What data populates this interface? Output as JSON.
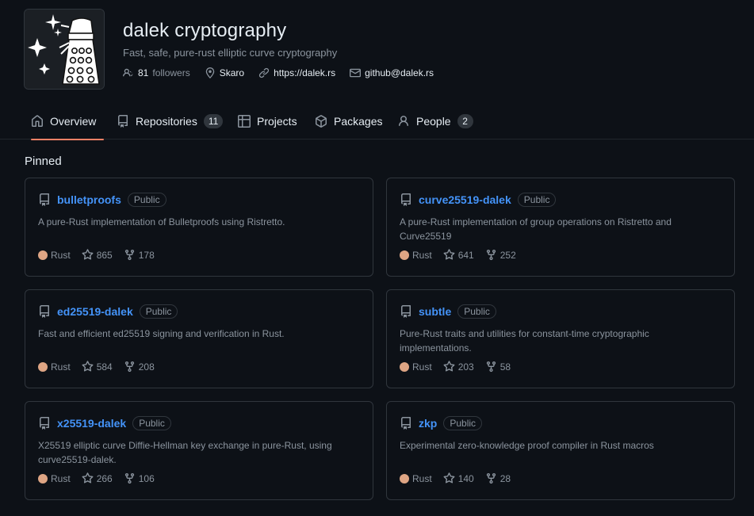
{
  "org": {
    "name": "dalek cryptography",
    "description": "Fast, safe, pure-rust elliptic curve cryptography",
    "followers_count": "81",
    "followers_label": "followers",
    "location": "Skaro",
    "website": "https://dalek.rs",
    "email": "github@dalek.rs"
  },
  "tabs": [
    {
      "label": "Overview",
      "icon": "home-icon",
      "active": true
    },
    {
      "label": "Repositories",
      "icon": "repo-icon",
      "count": "11"
    },
    {
      "label": "Projects",
      "icon": "table-icon"
    },
    {
      "label": "Packages",
      "icon": "package-icon"
    },
    {
      "label": "People",
      "icon": "person-icon",
      "count": "2"
    }
  ],
  "pinned": {
    "title": "Pinned",
    "repos": [
      {
        "name": "bulletproofs",
        "visibility": "Public",
        "description": "A pure-Rust implementation of Bulletproofs using Ristretto.",
        "language": "Rust",
        "lang_color": "#dea584",
        "stars": "865",
        "forks": "178"
      },
      {
        "name": "curve25519-dalek",
        "visibility": "Public",
        "description": "A pure-Rust implementation of group operations on Ristretto and Curve25519",
        "language": "Rust",
        "lang_color": "#dea584",
        "stars": "641",
        "forks": "252"
      },
      {
        "name": "ed25519-dalek",
        "visibility": "Public",
        "description": "Fast and efficient ed25519 signing and verification in Rust.",
        "language": "Rust",
        "lang_color": "#dea584",
        "stars": "584",
        "forks": "208"
      },
      {
        "name": "subtle",
        "visibility": "Public",
        "description": "Pure-Rust traits and utilities for constant-time cryptographic implementations.",
        "language": "Rust",
        "lang_color": "#dea584",
        "stars": "203",
        "forks": "58"
      },
      {
        "name": "x25519-dalek",
        "visibility": "Public",
        "description": "X25519 elliptic curve Diffie-Hellman key exchange in pure-Rust, using curve25519-dalek.",
        "language": "Rust",
        "lang_color": "#dea584",
        "stars": "266",
        "forks": "106"
      },
      {
        "name": "zkp",
        "visibility": "Public",
        "description": "Experimental zero-knowledge proof compiler in Rust macros",
        "language": "Rust",
        "lang_color": "#dea584",
        "stars": "140",
        "forks": "28"
      }
    ]
  },
  "colors": {
    "background": "#0d1117",
    "link": "#4493f8",
    "tab_underline": "#f78166",
    "muted": "#8b949e",
    "border": "#30363d"
  }
}
